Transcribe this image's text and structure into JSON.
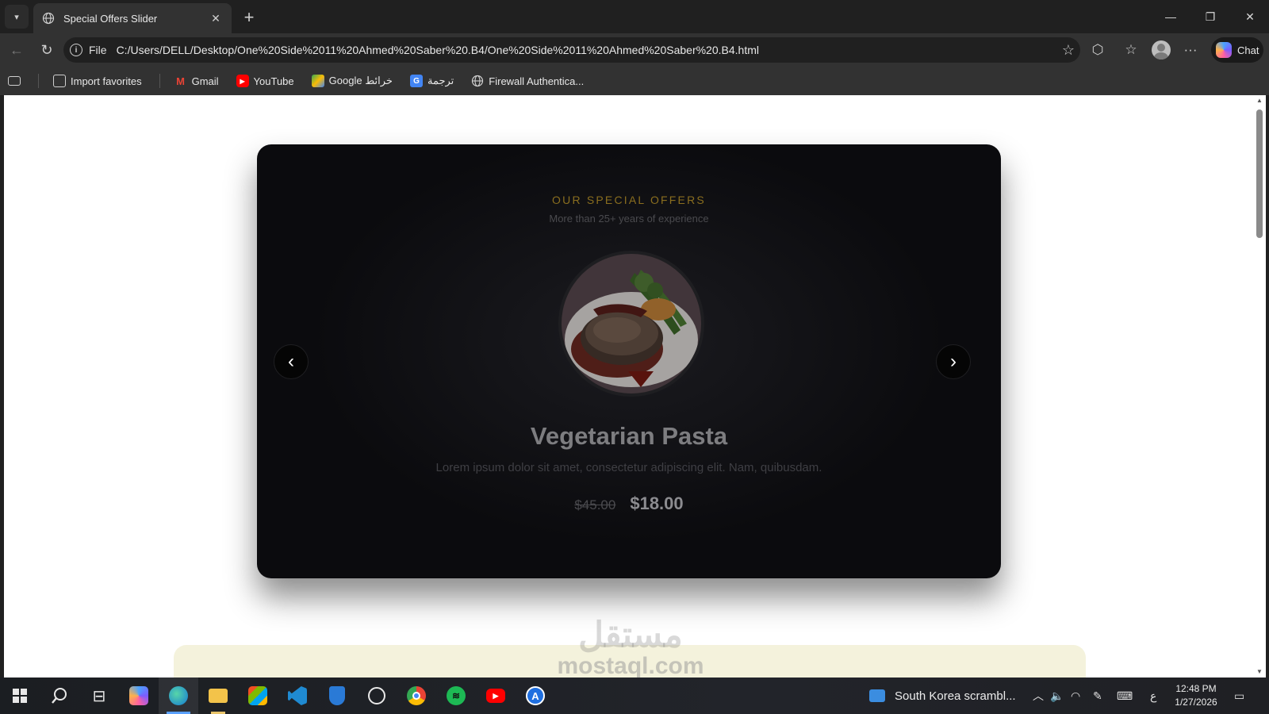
{
  "browser": {
    "tab": {
      "title": "Special Offers Slider"
    },
    "address": {
      "scheme_label": "File",
      "url": "C:/Users/DELL/Desktop/One%20Side%2011%20Ahmed%20Saber%20.B4/One%20Side%2011%20Ahmed%20Saber%20.B4.html"
    },
    "chat_label": "Chat",
    "bookmarks": [
      {
        "label": "Import favorites",
        "icon": "import-icon"
      },
      {
        "label": "Gmail",
        "icon": "gmail-icon"
      },
      {
        "label": "YouTube",
        "icon": "youtube-icon"
      },
      {
        "label": "Google خرائط",
        "icon": "maps-icon"
      },
      {
        "label": "ترجمة",
        "icon": "translate-icon"
      },
      {
        "label": "Firewall Authentica...",
        "icon": "globe-icon"
      }
    ]
  },
  "page": {
    "eyebrow": "OUR SPECIAL OFFERS",
    "subtitle": "More than 25+ years of experience",
    "dish": {
      "name": "Vegetarian Pasta",
      "description": "Lorem ipsum dolor sit amet, consectetur adipiscing elit. Nam, quibusdam.",
      "old_price": "$45.00",
      "new_price": "$18.00"
    },
    "prev_arrow": "‹",
    "next_arrow": "›",
    "accent_color": "#8a6e1f"
  },
  "watermark": {
    "arabic": "مستقل",
    "latin": "mostaql.com"
  },
  "taskbar": {
    "news": "South Korea scrambl...",
    "input_indicator": "ع",
    "time": "12:48 PM",
    "date": "1/27/2026"
  }
}
